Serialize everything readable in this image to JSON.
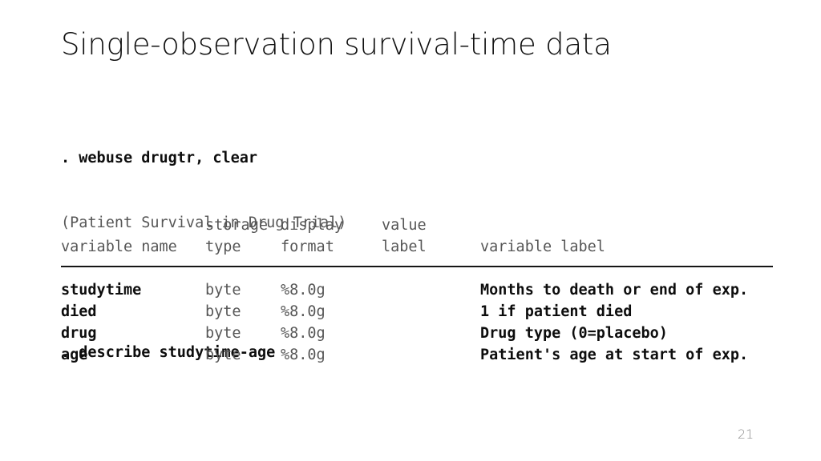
{
  "slide": {
    "title": "Single-observation survival-time data",
    "page_number": "21",
    "background_color": "#ffffff",
    "text_color_bold": "#0d0d0d",
    "text_color_output": "#565656",
    "rule_color": "#151515",
    "page_number_color": "#8e8e8e"
  },
  "console": {
    "command_1": ". webuse drugtr, clear",
    "output_1": "(Patient Survival in Drug Trial)",
    "command_2": ". describe studytime-age"
  },
  "describe_table": {
    "header_top": {
      "variable_name": "",
      "type": "storage",
      "format": "display",
      "value_label": "value",
      "variable_label": ""
    },
    "header_bottom": {
      "variable_name": "variable name",
      "type": "type",
      "format": "format",
      "value_label": "label",
      "variable_label": "variable label"
    },
    "rows": [
      {
        "variable_name": "studytime",
        "type": "byte",
        "format": "%8.0g",
        "value_label": "",
        "variable_label": "Months to death or end of exp."
      },
      {
        "variable_name": "died",
        "type": "byte",
        "format": "%8.0g",
        "value_label": "",
        "variable_label": "1 if patient died"
      },
      {
        "variable_name": "drug",
        "type": "byte",
        "format": "%8.0g",
        "value_label": "",
        "variable_label": "Drug type (0=placebo)"
      },
      {
        "variable_name": "age",
        "type": "byte",
        "format": "%8.0g",
        "value_label": "",
        "variable_label": "Patient's age at start of exp."
      }
    ]
  }
}
